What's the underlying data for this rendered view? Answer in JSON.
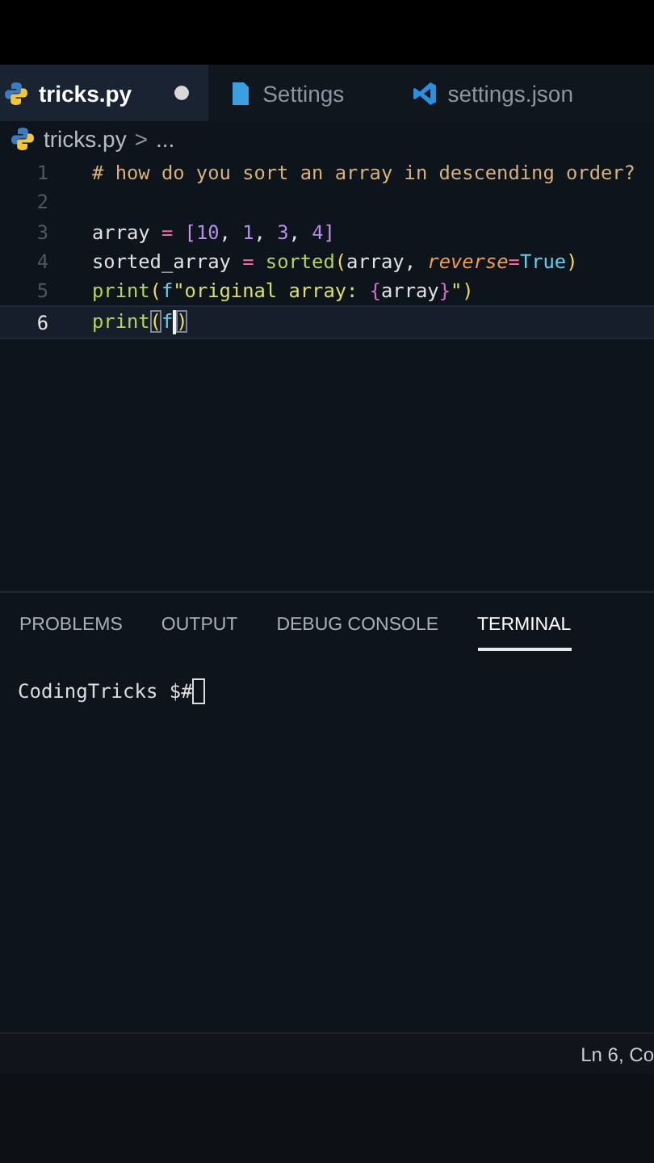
{
  "tabs": [
    {
      "label": "tricks.py",
      "kind": "python",
      "selected": true,
      "modified": true
    },
    {
      "label": "Settings",
      "kind": "file",
      "selected": false,
      "modified": false
    },
    {
      "label": "settings.json",
      "kind": "vscode",
      "selected": false,
      "modified": false
    }
  ],
  "breadcrumb": {
    "file": "tricks.py",
    "separator": ">",
    "rest": "..."
  },
  "code_lines": [
    {
      "number": "1",
      "current": false,
      "tokens": [
        {
          "text": "# how do you sort an array in descending order?",
          "kind": "comment"
        }
      ]
    },
    {
      "number": "2",
      "current": false
    },
    {
      "number": "3",
      "current": false,
      "tokens": [
        {
          "text": "array ",
          "kind": "var"
        },
        {
          "text": "= ",
          "kind": "op"
        },
        {
          "text": "[",
          "kind": "bracket"
        },
        {
          "text": "10",
          "kind": "num"
        },
        {
          "text": ", ",
          "kind": "var"
        },
        {
          "text": "1",
          "kind": "num"
        },
        {
          "text": ", ",
          "kind": "var"
        },
        {
          "text": "3",
          "kind": "num"
        },
        {
          "text": ", ",
          "kind": "var"
        },
        {
          "text": "4",
          "kind": "num"
        },
        {
          "text": "]",
          "kind": "bracket"
        }
      ]
    },
    {
      "number": "4",
      "current": false,
      "tokens": [
        {
          "text": "sorted_array ",
          "kind": "var"
        },
        {
          "text": "= ",
          "kind": "op"
        },
        {
          "text": "sorted",
          "kind": "func"
        },
        {
          "text": "(",
          "kind": "paren"
        },
        {
          "text": "array, ",
          "kind": "var"
        },
        {
          "text": "reverse",
          "kind": "param"
        },
        {
          "text": "=",
          "kind": "op"
        },
        {
          "text": "True",
          "kind": "const"
        },
        {
          "text": ")",
          "kind": "paren"
        }
      ]
    },
    {
      "number": "5",
      "current": false,
      "tokens": [
        {
          "text": "print",
          "kind": "func"
        },
        {
          "text": "(",
          "kind": "paren"
        },
        {
          "text": "f",
          "kind": "const"
        },
        {
          "text": "\"original array: ",
          "kind": "string"
        },
        {
          "text": "{",
          "kind": "brace"
        },
        {
          "text": "array",
          "kind": "var"
        },
        {
          "text": "}",
          "kind": "brace"
        },
        {
          "text": "\"",
          "kind": "string"
        },
        {
          "text": ")",
          "kind": "paren"
        }
      ]
    },
    {
      "number": "6",
      "current": true,
      "tokens": [
        {
          "text": "print",
          "kind": "func"
        },
        {
          "text": "(",
          "kind": "paren",
          "matched": true
        },
        {
          "text": "f",
          "kind": "const"
        },
        {
          "text": ")",
          "kind": "paren",
          "matched": true,
          "cursor_before": true
        }
      ]
    }
  ],
  "panel_tabs": [
    {
      "label": "PROBLEMS",
      "selected": false
    },
    {
      "label": "OUTPUT",
      "selected": false
    },
    {
      "label": "DEBUG CONSOLE",
      "selected": false
    },
    {
      "label": "TERMINAL",
      "selected": true
    }
  ],
  "terminal": {
    "prompt": "CodingTricks $#",
    "cursor": true
  },
  "status_bar": {
    "position": "Ln 6, Co"
  }
}
